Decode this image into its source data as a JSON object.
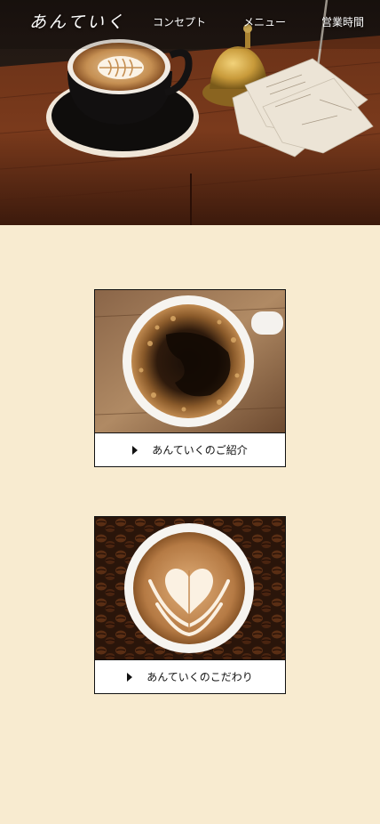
{
  "site": {
    "logo": "あんていく"
  },
  "nav": {
    "items": [
      {
        "label": "コンセプト"
      },
      {
        "label": "メニュー"
      },
      {
        "label": "営業時間"
      }
    ]
  },
  "cards": [
    {
      "label": "あんていくのご紹介"
    },
    {
      "label": "あんていくのこだわり"
    }
  ],
  "colors": {
    "page_background": "#f8ebd0",
    "card_border": "#111111",
    "nav_text": "#ffffff"
  }
}
